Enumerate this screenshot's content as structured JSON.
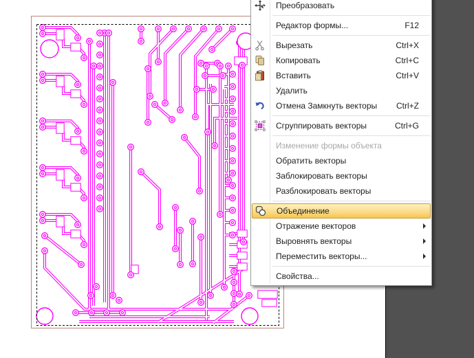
{
  "app": {
    "description": "vector CAM editor canvas with PCB artwork, selection marquee and right-click context menu"
  },
  "colors": {
    "trace": "#ff00ff",
    "page_border": "#ba8779",
    "selection": "#000000",
    "workspace_background": "#515151",
    "canvas_background": "#ffffff",
    "menu_background": "#ffffff",
    "menu_text": "#1e1e1e",
    "menu_disabled_text": "#a8a8a8",
    "highlight_border": "#c79c3f",
    "highlight_top": "#fdf0bd",
    "highlight_bottom": "#f7c64a"
  },
  "canvas": {
    "selection_style": "dashed-marquee",
    "content": "pcb-vector-artwork"
  },
  "menu": {
    "items": [
      {
        "id": "transform",
        "label": "Преобразовать",
        "icon": "transform-icon",
        "separator_after": true
      },
      {
        "id": "shape-editor",
        "label": "Редактор формы...",
        "shortcut": "F12",
        "separator_after": true
      },
      {
        "id": "cut",
        "label": "Вырезать",
        "icon": "scissors-icon",
        "shortcut": "Ctrl+X"
      },
      {
        "id": "copy",
        "label": "Копировать",
        "icon": "copy-icon",
        "shortcut": "Ctrl+C"
      },
      {
        "id": "paste",
        "label": "Вставить",
        "icon": "paste-icon",
        "shortcut": "Ctrl+V"
      },
      {
        "id": "delete",
        "label": "Удалить"
      },
      {
        "id": "undo-close-vectors",
        "label": "Отмена Замкнуть векторы",
        "icon": "undo-icon",
        "shortcut": "Ctrl+Z",
        "separator_after": true
      },
      {
        "id": "group-vectors",
        "label": "Сгруппировать векторы",
        "icon": "group-icon",
        "shortcut": "Ctrl+G",
        "separator_after": true
      },
      {
        "id": "edit-object-shape",
        "label": "Изменение формы объекта",
        "disabled": true
      },
      {
        "id": "reverse-vectors",
        "label": "Обратить векторы"
      },
      {
        "id": "lock-vectors",
        "label": "Заблокировать векторы"
      },
      {
        "id": "unlock-vectors",
        "label": "Разблокировать векторы",
        "separator_after": true
      },
      {
        "id": "union",
        "label": "Объединение",
        "icon": "union-icon",
        "highlighted": true
      },
      {
        "id": "mirror-vectors",
        "label": "Отражение векторов",
        "submenu": true
      },
      {
        "id": "align-vectors",
        "label": "Выровнять векторы",
        "submenu": true
      },
      {
        "id": "move-vectors",
        "label": "Переместить векторы...",
        "submenu": true,
        "separator_after": true
      },
      {
        "id": "properties",
        "label": "Свойства..."
      }
    ]
  }
}
